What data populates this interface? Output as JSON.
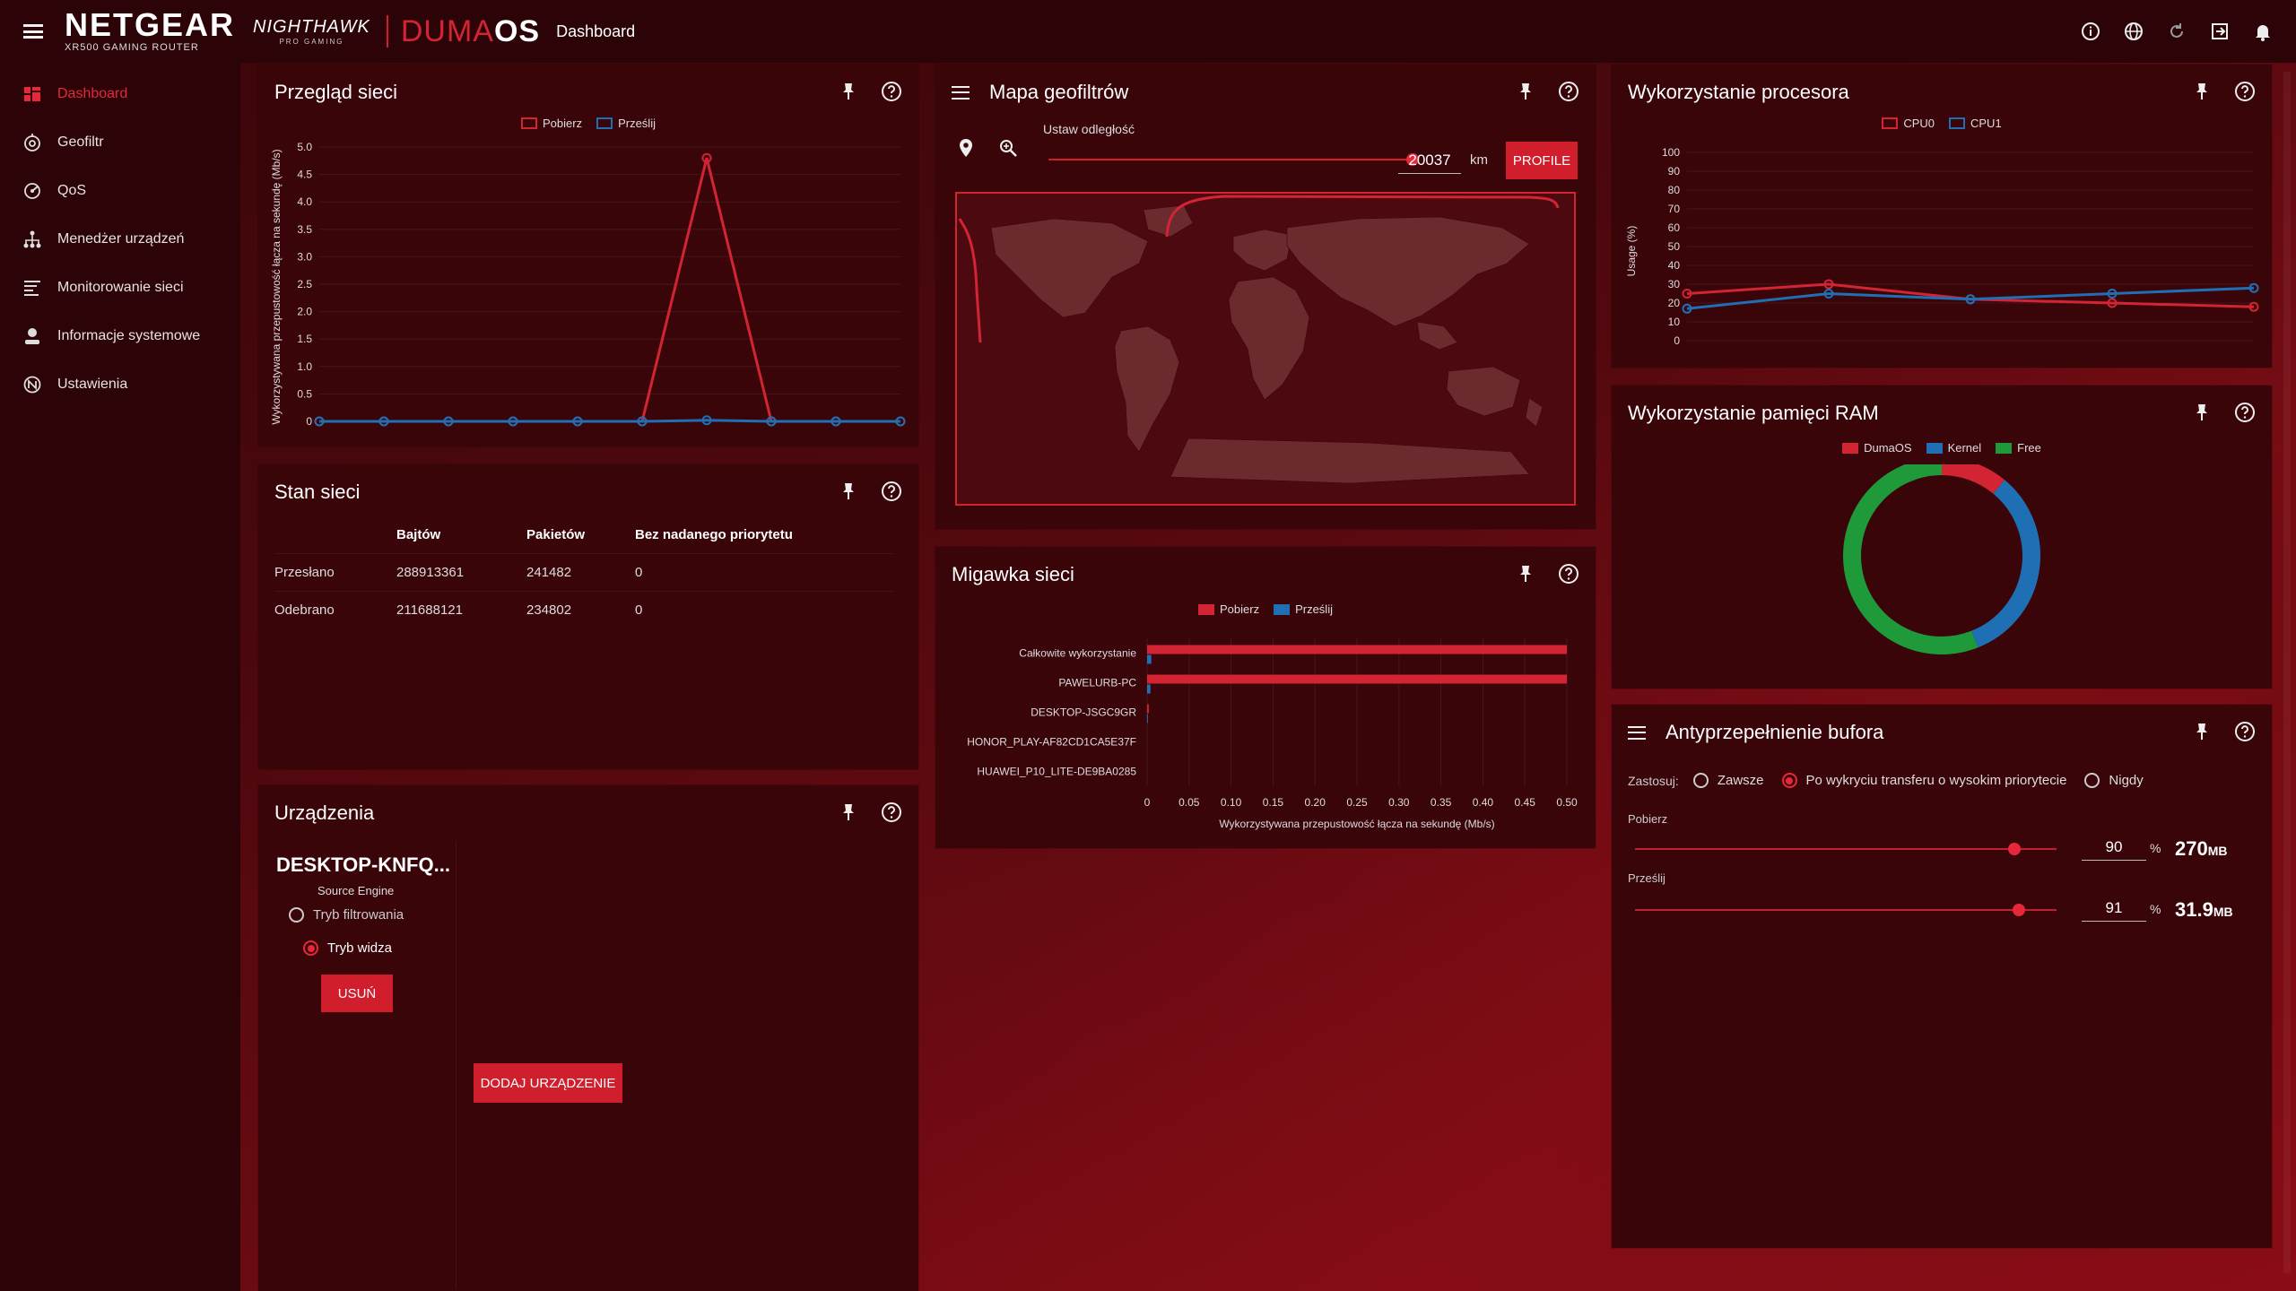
{
  "header": {
    "brand": "NETGEAR",
    "brand_sub": "XR500 GAMING ROUTER",
    "nighthawk": "NIGHTHAWK",
    "nighthawk_sub": "PRO GAMING",
    "duma_a": "DUMA",
    "duma_b": "OS",
    "breadcrumb": "Dashboard",
    "icons": [
      "info-icon",
      "globe-icon",
      "refresh-icon",
      "logout-icon",
      "bell-icon"
    ]
  },
  "sidebar": {
    "items": [
      {
        "label": "Dashboard",
        "icon": "dashboard-icon",
        "active": true
      },
      {
        "label": "Geofiltr",
        "icon": "geofilter-icon"
      },
      {
        "label": "QoS",
        "icon": "qos-icon"
      },
      {
        "label": "Menedżer urządzeń",
        "icon": "device-manager-icon"
      },
      {
        "label": "Monitorowanie sieci",
        "icon": "network-monitor-icon"
      },
      {
        "label": "Informacje systemowe",
        "icon": "system-info-icon"
      },
      {
        "label": "Ustawienia",
        "icon": "settings-icon"
      }
    ]
  },
  "colors": {
    "accent": "#d01e2c",
    "download": "#d32433",
    "upload": "#1f6fb5",
    "free": "#1e9a3a"
  },
  "network_overview": {
    "title": "Przegląd sieci",
    "legend_down": "Pobierz",
    "legend_up": "Prześlij",
    "ylabel": "Wykorzystywana przepustowość łącza na sekundę (Mb/s)"
  },
  "network_state": {
    "title": "Stan sieci",
    "columns": [
      "",
      "Bajtów",
      "Pakietów",
      "Bez nadanego priorytetu"
    ],
    "rows": [
      {
        "label": "Przesłano",
        "bytes": "288913361",
        "packets": "241482",
        "nopri": "0"
      },
      {
        "label": "Odebrano",
        "bytes": "211688121",
        "packets": "234802",
        "nopri": "0"
      }
    ]
  },
  "devices": {
    "title": "Urządzenia",
    "device_name": "DESKTOP-KNFQ...",
    "engine": "Source Engine",
    "mode_filter": "Tryb filtrowania",
    "mode_spectator": "Tryb widza",
    "remove": "USUŃ",
    "add_device": "DODAJ URZĄDZENIE"
  },
  "geo_map": {
    "title": "Mapa geofiltrów",
    "distance_label": "Ustaw odległość",
    "distance_value": "20037",
    "unit": "km",
    "profile_button": "PROFILE",
    "distance_fraction": 1.0
  },
  "snapshot": {
    "title": "Migawka sieci",
    "legend_down": "Pobierz",
    "legend_up": "Prześlij"
  },
  "cpu": {
    "title": "Wykorzystanie procesora",
    "legend_cpu0": "CPU0",
    "legend_cpu1": "CPU1"
  },
  "ram": {
    "title": "Wykorzystanie pamięci RAM",
    "legend": [
      "DumaOS",
      "Kernel",
      "Free"
    ]
  },
  "bufferbloat": {
    "title": "Antyprzepełnienie bufora",
    "apply_label": "Zastosuj:",
    "options": [
      "Zawsze",
      "Po wykryciu transferu o wysokim priorytecie",
      "Nigdy"
    ],
    "selected_option": 1,
    "download_label": "Pobierz",
    "download_percent": "90",
    "download_size": "270",
    "download_size_unit": "MB",
    "upload_label": "Prześlij",
    "upload_percent": "91",
    "upload_size": "31.9",
    "upload_size_unit": "MB",
    "percent_sign": "%"
  },
  "chart_data": [
    {
      "id": "network_overview",
      "type": "line",
      "yticks": [
        "0",
        "0.5",
        "1.0",
        "1.5",
        "2.0",
        "2.5",
        "3.0",
        "3.5",
        "4.0",
        "4.5",
        "5.0"
      ],
      "ylim": [
        0,
        5.0
      ],
      "series": [
        {
          "name": "Pobierz",
          "color": "#d32433",
          "values": [
            0,
            0,
            0,
            0,
            0,
            0,
            4.8,
            0,
            0,
            0
          ]
        },
        {
          "name": "Prześlij",
          "color": "#1f6fb5",
          "values": [
            0,
            0,
            0,
            0,
            0,
            0,
            0.02,
            0,
            0,
            0
          ]
        }
      ]
    },
    {
      "id": "snapshot",
      "type": "bar",
      "orientation": "horizontal",
      "categories": [
        "Całkowite wykorzystanie",
        "PAWELURB-PC",
        "DESKTOP-JSGC9GR",
        "HONOR_PLAY-AF82CD1CA5E37F",
        "HUAWEI_P10_LITE-DE9BA0285"
      ],
      "xticks": [
        "0",
        "0.05",
        "0.10",
        "0.15",
        "0.20",
        "0.25",
        "0.30",
        "0.35",
        "0.40",
        "0.45",
        "0.50"
      ],
      "xlim": [
        0,
        0.5
      ],
      "xlabel": "Wykorzystywana przepustowość łącza na sekundę (Mb/s)",
      "series": [
        {
          "name": "Pobierz",
          "color": "#d32433",
          "values": [
            0.5,
            0.5,
            0.002,
            0,
            0
          ]
        },
        {
          "name": "Prześlij",
          "color": "#1f6fb5",
          "values": [
            0.005,
            0.004,
            0.001,
            0,
            0
          ]
        }
      ]
    },
    {
      "id": "cpu",
      "type": "line",
      "ylabel": "Usage (%)",
      "yticks": [
        "0",
        "10",
        "20",
        "30",
        "40",
        "50",
        "60",
        "70",
        "80",
        "90",
        "100"
      ],
      "ylim": [
        0,
        100
      ],
      "series": [
        {
          "name": "CPU0",
          "color": "#d32433",
          "values": [
            25,
            30,
            22,
            20,
            18
          ]
        },
        {
          "name": "CPU1",
          "color": "#1f6fb5",
          "values": [
            17,
            25,
            22,
            25,
            28
          ]
        }
      ]
    },
    {
      "id": "ram",
      "type": "pie",
      "donut": true,
      "categories": [
        "DumaOS",
        "Kernel",
        "Free"
      ],
      "values": [
        11,
        33,
        56
      ],
      "colors": [
        "#d32433",
        "#1f6fb5",
        "#1e9a3a"
      ]
    }
  ]
}
